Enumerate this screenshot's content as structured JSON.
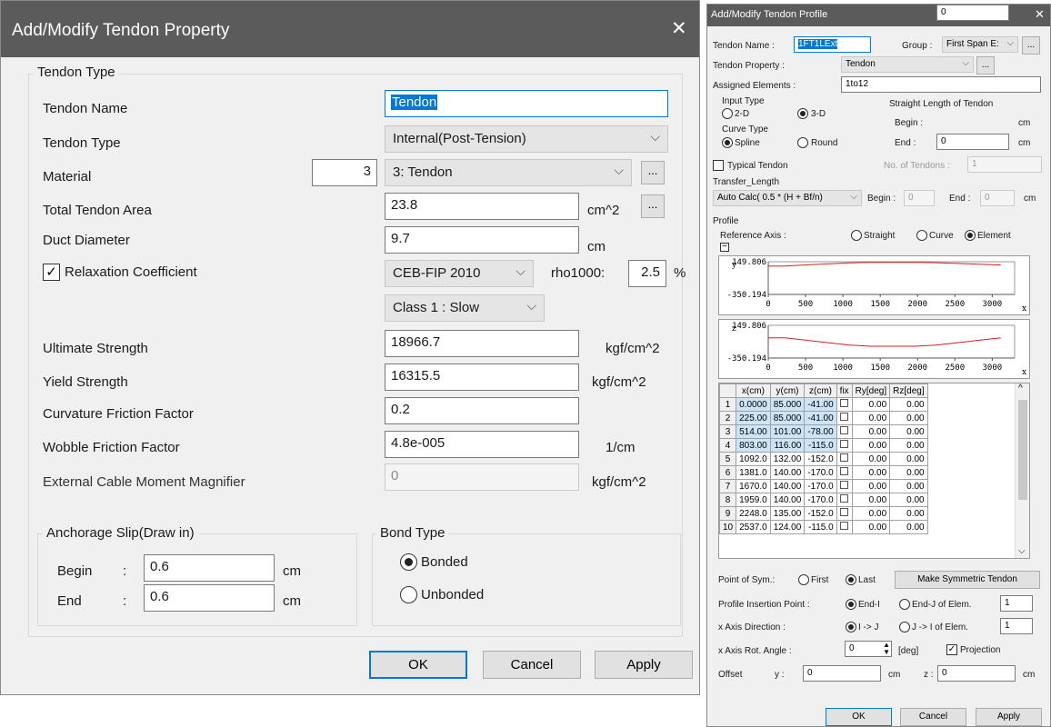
{
  "tp": {
    "title": "Add/Modify Tendon Property",
    "close": "✕",
    "grp_tendon_type": "Tendon Type",
    "name_label": "Tendon Name",
    "name_value": "Tendon",
    "type_label": "Tendon Type",
    "type_value": "Internal(Post-Tension)",
    "material_label": "Material",
    "material_id": "3",
    "material_value": "3: Tendon",
    "area_label": "Total Tendon Area",
    "area_value": "23.8",
    "area_unit": "cm^2",
    "duct_label": "Duct Diameter",
    "duct_value": "9.7",
    "duct_unit": "cm",
    "relax_label": "Relaxation Coefficient",
    "relax_checked": true,
    "relax_value": "CEB-FIP 2010",
    "rho_label": "rho1000:",
    "rho_value": "2.5",
    "rho_unit": "%",
    "class_value": "Class 1 : Slow",
    "ult_label": "Ultimate Strength",
    "ult_value": "18966.7",
    "ult_unit": "kgf/cm^2",
    "yield_label": "Yield Strength",
    "yield_value": "16315.5",
    "yield_unit": "kgf/cm^2",
    "curv_label": "Curvature Friction Factor",
    "curv_value": "0.2",
    "wob_label": "Wobble Friction Factor",
    "wob_value": "4.8e-005",
    "wob_unit": "1/cm",
    "ext_label": "External Cable Moment Magnifier",
    "ext_value": "0",
    "ext_unit": "kgf/cm^2",
    "anch_title": "Anchorage Slip(Draw in)",
    "begin_label": "Begin",
    "begin_value": "0.6",
    "end_label": "End",
    "end_value": "0.6",
    "cm": "cm",
    "colon": ":",
    "bond_title": "Bond Type",
    "bonded": "Bonded",
    "unbonded": "Unbonded",
    "ok": "OK",
    "cancel": "Cancel",
    "apply": "Apply",
    "dots": "..."
  },
  "pf": {
    "title": "Add/Modify Tendon Profile",
    "close": "✕",
    "name_label": "Tendon Name  :",
    "name_value": "1FT1LExt",
    "group_label": "Group :",
    "group_value": "First Span E:",
    "prop_label": "Tendon Property    :",
    "prop_value": "Tendon",
    "assigned_label": "Assigned Elements  :",
    "assigned_value": "1to12",
    "input_type": "Input Type",
    "r2d": "2-D",
    "r3d": "3-D",
    "curve_type": "Curve Type",
    "spline": "Spline",
    "round": "Round",
    "straight_len": "Straight Length of Tendon",
    "begin": "Begin :",
    "begin_value": "0",
    "end": "End :",
    "end_value": "0",
    "cm": "cm",
    "typical": "Typical Tendon",
    "num_tendons": "No. of Tendons :",
    "num_value": "1",
    "transfer": "Transfer_Length",
    "transfer_value": "Auto Calc( 0.5 * (H + Bf/n)",
    "t_begin": "Begin :",
    "t_begin_value": "0",
    "t_end": "End :",
    "t_end_value": "0",
    "profile": "Profile",
    "ref_axis": "Reference Axis        :",
    "straight": "Straight",
    "curve": "Curve",
    "element": "Element",
    "sym_label": "Point of Sym.:",
    "first": "First",
    "last": "Last",
    "make_sym": "Make Symmetric Tendon",
    "ins_label": "Profile Insertion Point :",
    "endi": "End-I",
    "endj": "End-J of Elem.",
    "ins_value": "1",
    "xdir_label": "x Axis Direction  :",
    "ij": "I -> J",
    "ji": "J -> I of Elem.",
    "xdir_value": "1",
    "xrot_label": "x Axis Rot. Angle :",
    "xrot_value": "0",
    "deg": "[deg]",
    "projection": "Projection",
    "offset_label": "Offset",
    "y_label": "y :",
    "y_value": "0",
    "z_label": "z :",
    "z_value": "0",
    "ok": "OK",
    "cancel": "Cancel",
    "apply": "Apply",
    "dots": "..."
  },
  "chart_data": [
    {
      "type": "line",
      "ylabel": "y",
      "xlabel": "x",
      "yticks": [
        "149.806",
        "-350.194"
      ],
      "xticks": [
        "0",
        "500",
        "1000",
        "1500",
        "2000",
        "2500",
        "3000"
      ],
      "series": [
        {
          "x": [
            0,
            225,
            514,
            803,
            1092,
            1381,
            1670,
            1959,
            2248,
            2537,
            2826,
            3115
          ],
          "values": [
            85,
            85,
            101,
            116,
            132,
            140,
            140,
            140,
            135,
            124,
            113,
            100
          ]
        }
      ],
      "ylim": [
        -350.194,
        149.806
      ],
      "xlim": [
        0,
        3300
      ]
    },
    {
      "type": "line",
      "ylabel": "z",
      "xlabel": "x",
      "yticks": [
        "149.806",
        "-350.194"
      ],
      "xticks": [
        "0",
        "500",
        "1000",
        "1500",
        "2000",
        "2500",
        "3000"
      ],
      "series": [
        {
          "x": [
            0,
            225,
            514,
            803,
            1092,
            1381,
            1670,
            1959,
            2248,
            2537,
            2826,
            3115
          ],
          "values": [
            -41,
            -41,
            -78,
            -115,
            -152,
            -170,
            -170,
            -170,
            -152,
            -115,
            -78,
            -41
          ]
        }
      ],
      "ylim": [
        -350.194,
        149.806
      ],
      "xlim": [
        0,
        3300
      ]
    }
  ],
  "table": {
    "headers": [
      "x(cm)",
      "y(cm)",
      "z(cm)",
      "fix",
      "Ry[deg]",
      "Rz[deg]"
    ],
    "rows": [
      [
        "1",
        "0.0000",
        "85.000",
        "-41.00",
        "0.00",
        "0.00"
      ],
      [
        "2",
        "225.00",
        "85.000",
        "-41.00",
        "0.00",
        "0.00"
      ],
      [
        "3",
        "514.00",
        "101.00",
        "-78.00",
        "0.00",
        "0.00"
      ],
      [
        "4",
        "803.00",
        "116.00",
        "-115.0",
        "0.00",
        "0.00"
      ],
      [
        "5",
        "1092.0",
        "132.00",
        "-152.0",
        "0.00",
        "0.00"
      ],
      [
        "6",
        "1381.0",
        "140.00",
        "-170.0",
        "0.00",
        "0.00"
      ],
      [
        "7",
        "1670.0",
        "140.00",
        "-170.0",
        "0.00",
        "0.00"
      ],
      [
        "8",
        "1959.0",
        "140.00",
        "-170.0",
        "0.00",
        "0.00"
      ],
      [
        "9",
        "2248.0",
        "135.00",
        "-152.0",
        "0.00",
        "0.00"
      ],
      [
        "10",
        "2537.0",
        "124.00",
        "-115.0",
        "0.00",
        "0.00"
      ]
    ]
  }
}
